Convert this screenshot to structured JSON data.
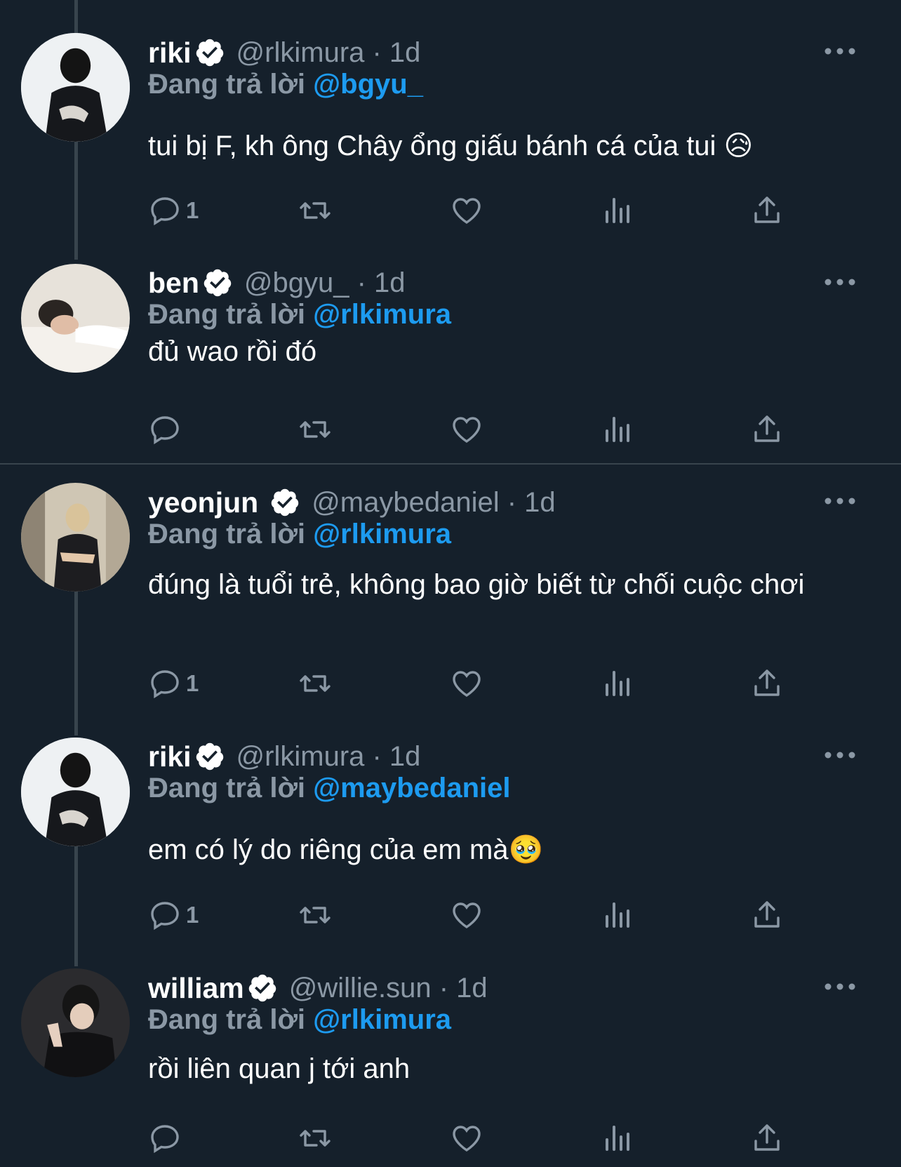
{
  "reply_prefix": "Đang trả lời",
  "tweets": [
    {
      "name": "riki",
      "handle_time": "@rlkimura · 1d",
      "reply_to": "@bgyu_",
      "text": "tui bị F, kh ông Chây ổng giấu bánh cá của tui 😥",
      "reply_count": "1",
      "avatar": "riki-avatar"
    },
    {
      "name": "ben",
      "handle_time": "@bgyu_ · 1d",
      "reply_to": "@rlkimura",
      "text": "đủ wao rồi đó",
      "reply_count": "",
      "avatar": "ben-avatar"
    },
    {
      "name": "yeonjun",
      "handle_time": "@maybedaniel · 1d",
      "reply_to": "@rlkimura",
      "text": "đúng là tuổi trẻ, không bao giờ biết từ chối cuộc chơi",
      "reply_count": "1",
      "avatar": "yeonjun-avatar"
    },
    {
      "name": "riki",
      "handle_time": "@rlkimura · 1d",
      "reply_to": "@maybedaniel",
      "text": "em có lý do riêng của em mà🥹",
      "reply_count": "1",
      "avatar": "riki-avatar"
    },
    {
      "name": "william",
      "handle_time": "@willie.sun · 1d",
      "reply_to": "@rlkimura",
      "text": "rồi liên quan j tới anh",
      "reply_count": "",
      "avatar": "william-avatar"
    }
  ],
  "colors": {
    "background": "#15202b",
    "mention": "#1d9bf0",
    "secondary_text": "#8b98a5",
    "thread_line": "#38444d"
  },
  "icons": [
    "verified-badge-icon",
    "more-icon",
    "reply-icon",
    "retweet-icon",
    "like-icon",
    "analytics-icon",
    "share-icon"
  ]
}
